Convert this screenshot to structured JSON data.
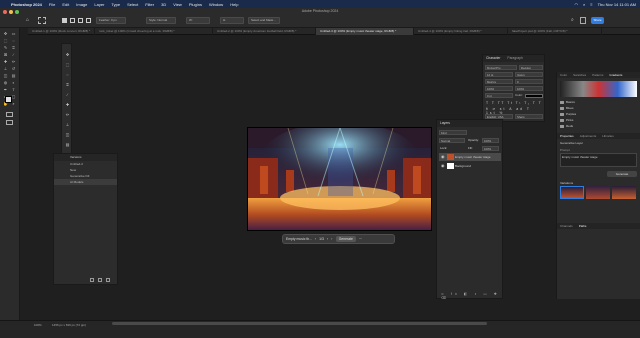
{
  "menubar": {
    "app_name": "Photoshop 2024",
    "items": [
      "File",
      "Edit",
      "Image",
      "Layer",
      "Type",
      "Select",
      "Filter",
      "3D",
      "View",
      "Plugins",
      "Window",
      "Help"
    ],
    "clock": "Thu Nov 14  11:01 AM"
  },
  "window": {
    "title": "Adobe Photoshop 2024"
  },
  "options": {
    "feather_label": "Feather:",
    "feather_value": "0 px",
    "style_label": "Style:",
    "style_value": "Normal",
    "width_label": "W:",
    "height_label": "H:",
    "select_mask": "Select and Mask...",
    "share": "Share"
  },
  "tabs": [
    {
      "label": "Untitled-1 @ 100% (Rock concert, RGB/8) *",
      "active": false
    },
    {
      "label": "rock_ticket @ 100% (Crowd cheering at a rock, RGB/8) *",
      "active": false
    },
    {
      "label": "Untitled-2 @ 100% (Empty American football field, RGB/8) *",
      "active": false
    },
    {
      "label": "Untitled-3 @ 100% (Empty music theater stage, RGB/8) *",
      "active": true
    },
    {
      "label": "Untitled-4 @ 100% (Empty hiking trail, RGB/8) *",
      "active": false
    },
    {
      "label": "fakeProject.psd @ 100% (Fall, CMYK/8) *",
      "active": false
    }
  ],
  "history": {
    "title": "Versions",
    "items": [
      "Untitled-3",
      "New",
      "Generative Fill",
      "AI Models"
    ]
  },
  "context_bar": {
    "prompt": "Empty music th...",
    "count": "1/3",
    "generate": "Generate"
  },
  "layers": {
    "title": "Layers",
    "kind": "Kind",
    "blend": "Normal",
    "opacity_label": "Opacity:",
    "opacity": "100%",
    "lock_label": "Lock:",
    "fill_label": "Fill:",
    "fill": "100%",
    "rows": [
      {
        "name": "Empty music theater stage",
        "selected": true
      },
      {
        "name": "Background",
        "selected": false
      }
    ]
  },
  "character": {
    "tabs": [
      "Character",
      "Paragraph"
    ],
    "font_family": "Myriad Pro",
    "font_style": "Regular",
    "size": "12 pt",
    "leading": "(Auto)",
    "kerning": "Metrics",
    "tracking": "0",
    "scale_v": "100%",
    "scale_h": "100%",
    "baseline": "0 pt",
    "color_label": "Color:",
    "lang": "English: USA",
    "aa": "Sharp"
  },
  "dock": {
    "top_tabs": [
      "Color",
      "Swatches",
      "Patterns",
      "Gradients"
    ],
    "folders": [
      "Basics",
      "Blues",
      "Purples",
      "Pinks",
      "Reds"
    ],
    "props_tabs": [
      "Properties",
      "Adjustments",
      "Libraries"
    ],
    "props_type": "Generative Layer",
    "prompt_label": "Prompt",
    "prompt_text": "Empty music theater stage",
    "generate": "Generate",
    "variations": "Variations",
    "bottom_tabs": [
      "Channels",
      "Paths"
    ]
  },
  "status": {
    "zoom": "100%",
    "doc_info": "1456 px x 816 px (72 ppi)"
  }
}
